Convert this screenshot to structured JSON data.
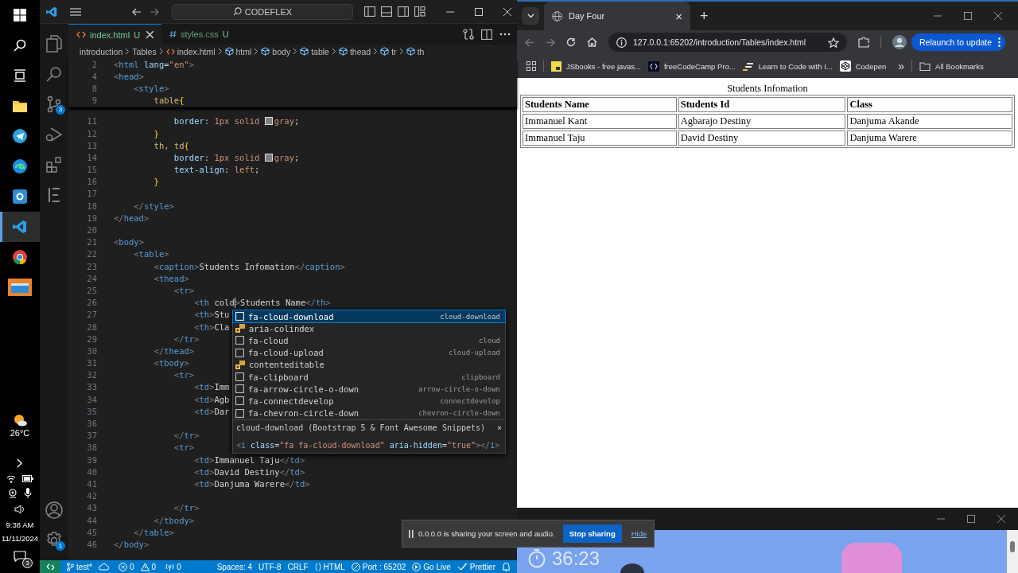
{
  "taskbar": {
    "apps": [
      {
        "kind": "start",
        "selected": false
      },
      {
        "kind": "search",
        "selected": false
      },
      {
        "kind": "taskview",
        "selected": false
      },
      {
        "kind": "folder",
        "selected": false
      },
      {
        "kind": "telegram",
        "selected": false
      },
      {
        "kind": "edge",
        "selected": false
      },
      {
        "kind": "camera",
        "selected": false
      },
      {
        "kind": "vscode",
        "selected": true
      },
      {
        "kind": "chrome",
        "selected": false
      },
      {
        "kind": "window",
        "selected": false
      }
    ],
    "weather": "26°C",
    "time": "9:38 AM",
    "date": "11/11/2024",
    "notifications": "3"
  },
  "editor": {
    "command_center": "CODEFLEX",
    "tabs": [
      {
        "label": "index.html",
        "status": "U",
        "kind": "html",
        "selected": true
      },
      {
        "label": "styles.css",
        "status": "U",
        "kind": "css",
        "selected": false
      }
    ],
    "breadcrumbs": [
      {
        "label": "introduction",
        "kind": "folder"
      },
      {
        "label": "Tables",
        "kind": "folder"
      },
      {
        "label": "index.html",
        "kind": "file"
      },
      {
        "label": "html",
        "kind": "element"
      },
      {
        "label": "body",
        "kind": "element"
      },
      {
        "label": "table",
        "kind": "element"
      },
      {
        "label": "thead",
        "kind": "element"
      },
      {
        "label": "tr",
        "kind": "element"
      },
      {
        "label": "th",
        "kind": "element"
      }
    ],
    "activity": [
      {
        "kind": "explorer"
      },
      {
        "kind": "search"
      },
      {
        "kind": "source-control",
        "badge": "3"
      },
      {
        "kind": "run"
      },
      {
        "kind": "extensions"
      },
      {
        "kind": "outline"
      }
    ],
    "activity_bottom": [
      {
        "kind": "account"
      },
      {
        "kind": "settings",
        "badge": "1"
      }
    ],
    "sticky_lines": [
      {
        "n": "2",
        "tokens": [
          {
            "kind": "punct",
            "text": "<"
          },
          {
            "kind": "tag",
            "text": "html"
          },
          {
            "kind": "attr",
            "text": " lang"
          },
          {
            "kind": "text",
            "text": "="
          },
          {
            "kind": "string",
            "text": "\"en\""
          },
          {
            "kind": "punct",
            "text": ">"
          }
        ]
      },
      {
        "n": "4",
        "tokens": [
          {
            "kind": "punct",
            "text": "<"
          },
          {
            "kind": "tag",
            "text": "head"
          },
          {
            "kind": "punct",
            "text": ">"
          }
        ]
      },
      {
        "n": "8",
        "tokens": [
          {
            "kind": "punct",
            "text": "    <"
          },
          {
            "kind": "tag",
            "text": "style"
          },
          {
            "kind": "punct",
            "text": ">"
          }
        ]
      },
      {
        "n": "9",
        "tokens": [
          {
            "kind": "selector",
            "text": "        table"
          },
          {
            "kind": "brace",
            "text": "{"
          }
        ]
      }
    ],
    "lines": [
      {
        "n": "11",
        "tokens": [
          {
            "kind": "property",
            "text": "            border"
          },
          {
            "kind": "text",
            "text": ": "
          },
          {
            "kind": "value",
            "text": "1px solid "
          },
          {
            "kind": "swatch"
          },
          {
            "kind": "value",
            "text": "gray"
          },
          {
            "kind": "text",
            "text": ";"
          }
        ]
      },
      {
        "n": "12",
        "tokens": [
          {
            "kind": "brace",
            "text": "        }"
          }
        ]
      },
      {
        "n": "13",
        "tokens": [
          {
            "kind": "selector",
            "text": "        th, td"
          },
          {
            "kind": "brace",
            "text": "{"
          }
        ]
      },
      {
        "n": "14",
        "tokens": [
          {
            "kind": "property",
            "text": "            border"
          },
          {
            "kind": "text",
            "text": ": "
          },
          {
            "kind": "value",
            "text": "1px solid "
          },
          {
            "kind": "swatch"
          },
          {
            "kind": "value",
            "text": "gray"
          },
          {
            "kind": "text",
            "text": ";"
          }
        ]
      },
      {
        "n": "15",
        "tokens": [
          {
            "kind": "property",
            "text": "            text-align"
          },
          {
            "kind": "text",
            "text": ": "
          },
          {
            "kind": "value",
            "text": "left"
          },
          {
            "kind": "text",
            "text": ";"
          }
        ]
      },
      {
        "n": "16",
        "tokens": [
          {
            "kind": "brace",
            "text": "        }"
          }
        ]
      },
      {
        "n": "17"
      },
      {
        "n": "18",
        "tokens": [
          {
            "kind": "punct",
            "text": "    </"
          },
          {
            "kind": "tag",
            "text": "style"
          },
          {
            "kind": "punct",
            "text": ">"
          }
        ]
      },
      {
        "n": "19",
        "tokens": [
          {
            "kind": "punct",
            "text": "</"
          },
          {
            "kind": "tag",
            "text": "head"
          },
          {
            "kind": "punct",
            "text": ">"
          }
        ]
      },
      {
        "n": "20"
      },
      {
        "n": "21",
        "tokens": [
          {
            "kind": "punct",
            "text": "<"
          },
          {
            "kind": "tag",
            "text": "body"
          },
          {
            "kind": "punct",
            "text": ">"
          }
        ]
      },
      {
        "n": "22",
        "tokens": [
          {
            "kind": "punct",
            "text": "    <"
          },
          {
            "kind": "tag",
            "text": "table"
          },
          {
            "kind": "punct",
            "text": ">"
          }
        ]
      },
      {
        "n": "23",
        "tokens": [
          {
            "kind": "punct",
            "text": "        <"
          },
          {
            "kind": "tag",
            "text": "caption"
          },
          {
            "kind": "punct",
            "text": ">"
          },
          {
            "kind": "text",
            "text": "Students Infomation"
          },
          {
            "kind": "punct",
            "text": "</"
          },
          {
            "kind": "tag",
            "text": "caption"
          },
          {
            "kind": "punct",
            "text": ">"
          }
        ]
      },
      {
        "n": "24",
        "tokens": [
          {
            "kind": "punct",
            "text": "        <"
          },
          {
            "kind": "tag",
            "text": "thead"
          },
          {
            "kind": "punct",
            "text": ">"
          }
        ]
      },
      {
        "n": "25",
        "tokens": [
          {
            "kind": "punct",
            "text": "            <"
          },
          {
            "kind": "tag",
            "text": "tr"
          },
          {
            "kind": "punct",
            "text": ">"
          }
        ]
      },
      {
        "n": "26",
        "tokens": [
          {
            "kind": "punct",
            "text": "                <"
          },
          {
            "kind": "tag",
            "text": "th"
          },
          {
            "kind": "text",
            "text": " cold"
          },
          {
            "kind": "caret"
          },
          {
            "kind": "punct",
            "text": ">"
          },
          {
            "kind": "text",
            "text": "Students Name"
          },
          {
            "kind": "punct",
            "text": "</"
          },
          {
            "kind": "tag",
            "text": "th"
          },
          {
            "kind": "punct",
            "text": ">"
          }
        ]
      },
      {
        "n": "27",
        "tokens": [
          {
            "kind": "punct",
            "text": "                <"
          },
          {
            "kind": "tag",
            "text": "th"
          },
          {
            "kind": "punct",
            "text": ">"
          },
          {
            "kind": "text",
            "text": "Stu"
          }
        ]
      },
      {
        "n": "28",
        "tokens": [
          {
            "kind": "punct",
            "text": "                <"
          },
          {
            "kind": "tag",
            "text": "th"
          },
          {
            "kind": "punct",
            "text": ">"
          },
          {
            "kind": "text",
            "text": "Cla"
          }
        ]
      },
      {
        "n": "29",
        "tokens": [
          {
            "kind": "punct",
            "text": "            </"
          },
          {
            "kind": "tag",
            "text": "tr"
          },
          {
            "kind": "punct",
            "text": ">"
          }
        ]
      },
      {
        "n": "30",
        "tokens": [
          {
            "kind": "punct",
            "text": "        </"
          },
          {
            "kind": "tag",
            "text": "thead"
          },
          {
            "kind": "punct",
            "text": ">"
          }
        ]
      },
      {
        "n": "31",
        "tokens": [
          {
            "kind": "punct",
            "text": "        <"
          },
          {
            "kind": "tag",
            "text": "tbody"
          },
          {
            "kind": "punct",
            "text": ">"
          }
        ]
      },
      {
        "n": "32",
        "tokens": [
          {
            "kind": "punct",
            "text": "            <"
          },
          {
            "kind": "tag",
            "text": "tr"
          },
          {
            "kind": "punct",
            "text": ">"
          }
        ]
      },
      {
        "n": "33",
        "tokens": [
          {
            "kind": "punct",
            "text": "                <"
          },
          {
            "kind": "tag",
            "text": "td"
          },
          {
            "kind": "punct",
            "text": ">"
          },
          {
            "kind": "text",
            "text": "Imm"
          }
        ]
      },
      {
        "n": "34",
        "tokens": [
          {
            "kind": "punct",
            "text": "                <"
          },
          {
            "kind": "tag",
            "text": "td"
          },
          {
            "kind": "punct",
            "text": ">"
          },
          {
            "kind": "text",
            "text": "Agb"
          }
        ]
      },
      {
        "n": "35",
        "tokens": [
          {
            "kind": "punct",
            "text": "                <"
          },
          {
            "kind": "tag",
            "text": "td"
          },
          {
            "kind": "punct",
            "text": ">"
          },
          {
            "kind": "text",
            "text": "Dar"
          }
        ]
      },
      {
        "n": "36"
      },
      {
        "n": "37",
        "tokens": [
          {
            "kind": "punct",
            "text": "            </"
          },
          {
            "kind": "tag",
            "text": "tr"
          },
          {
            "kind": "punct",
            "text": ">"
          }
        ]
      },
      {
        "n": "38",
        "tokens": [
          {
            "kind": "punct",
            "text": "            <"
          },
          {
            "kind": "tag",
            "text": "tr"
          },
          {
            "kind": "punct",
            "text": ">"
          }
        ]
      },
      {
        "n": "39",
        "tokens": [
          {
            "kind": "punct",
            "text": "                <"
          },
          {
            "kind": "tag",
            "text": "td"
          },
          {
            "kind": "punct",
            "text": ">"
          },
          {
            "kind": "text",
            "text": "Immanuel Taju"
          },
          {
            "kind": "punct",
            "text": "</"
          },
          {
            "kind": "tag",
            "text": "td"
          },
          {
            "kind": "punct",
            "text": ">"
          }
        ]
      },
      {
        "n": "40",
        "tokens": [
          {
            "kind": "punct",
            "text": "                <"
          },
          {
            "kind": "tag",
            "text": "td"
          },
          {
            "kind": "punct",
            "text": ">"
          },
          {
            "kind": "text",
            "text": "David Destiny"
          },
          {
            "kind": "punct",
            "text": "</"
          },
          {
            "kind": "tag",
            "text": "td"
          },
          {
            "kind": "punct",
            "text": ">"
          }
        ]
      },
      {
        "n": "41",
        "tokens": [
          {
            "kind": "punct",
            "text": "                <"
          },
          {
            "kind": "tag",
            "text": "td"
          },
          {
            "kind": "punct",
            "text": ">"
          },
          {
            "kind": "text",
            "text": "Danjuma Warere"
          },
          {
            "kind": "punct",
            "text": "</"
          },
          {
            "kind": "tag",
            "text": "td"
          },
          {
            "kind": "punct",
            "text": ">"
          }
        ]
      },
      {
        "n": "42"
      },
      {
        "n": "43",
        "tokens": [
          {
            "kind": "punct",
            "text": "            </"
          },
          {
            "kind": "tag",
            "text": "tr"
          },
          {
            "kind": "punct",
            "text": ">"
          }
        ]
      },
      {
        "n": "44",
        "tokens": [
          {
            "kind": "punct",
            "text": "        </"
          },
          {
            "kind": "tag",
            "text": "tbody"
          },
          {
            "kind": "punct",
            "text": ">"
          }
        ]
      },
      {
        "n": "45",
        "tokens": [
          {
            "kind": "punct",
            "text": "    </"
          },
          {
            "kind": "tag",
            "text": "table"
          },
          {
            "kind": "punct",
            "text": ">"
          }
        ]
      },
      {
        "n": "46",
        "tokens": [
          {
            "kind": "punct",
            "text": "</"
          },
          {
            "kind": "tag",
            "text": "body"
          },
          {
            "kind": "punct",
            "text": ">"
          }
        ]
      }
    ],
    "suggestions": [
      {
        "label": "fa-cloud-download",
        "detail": "cloud-download",
        "kind": "snippet",
        "selected": true
      },
      {
        "label": "aria-colindex",
        "kind": "property",
        "selected": false
      },
      {
        "label": "fa-cloud",
        "detail": "cloud",
        "kind": "snippet",
        "selected": false
      },
      {
        "label": "fa-cloud-upload",
        "detail": "cloud-upload",
        "kind": "snippet",
        "selected": false
      },
      {
        "label": "contenteditable",
        "kind": "property",
        "selected": false
      },
      {
        "label": "fa-clipboard",
        "detail": "clipboard",
        "kind": "snippet",
        "selected": false
      },
      {
        "label": "fa-arrow-circle-o-down",
        "detail": "arrow-circle-o-down",
        "kind": "snippet",
        "selected": false
      },
      {
        "label": "fa-connectdevelop",
        "detail": "connectdevelop",
        "kind": "snippet",
        "selected": false
      },
      {
        "label": "fa-chevron-circle-down",
        "detail": "chevron-circle-down",
        "kind": "snippet",
        "selected": false
      }
    ],
    "suggestion_details": {
      "title": "cloud-download (Bootstrap 5 & Font Awesome Snippets)",
      "close": "×",
      "snippet": [
        {
          "kind": "punct",
          "text": "<"
        },
        {
          "kind": "tag",
          "text": "i"
        },
        {
          "kind": "attr",
          "text": " class"
        },
        {
          "kind": "text",
          "text": "="
        },
        {
          "kind": "string",
          "text": "\"fa fa-cloud-download\""
        },
        {
          "kind": "attr",
          "text": " aria-hidden"
        },
        {
          "kind": "text",
          "text": "="
        },
        {
          "kind": "string",
          "text": "\"true\""
        },
        {
          "kind": "punct",
          "text": "></"
        },
        {
          "kind": "tag",
          "text": "i"
        },
        {
          "kind": "punct",
          "text": ">"
        }
      ]
    },
    "status_bar": {
      "left": [
        {
          "kind": "remote"
        },
        {
          "kind": "branch",
          "label": "test*"
        },
        {
          "kind": "sync"
        },
        {
          "kind": "error",
          "label": "0"
        },
        {
          "kind": "warning",
          "label": "0"
        },
        {
          "kind": "ports",
          "label": "0"
        }
      ],
      "right": [
        {
          "kind": "text",
          "label": "Spaces: 4"
        },
        {
          "kind": "text",
          "label": "UTF-8"
        },
        {
          "kind": "text",
          "label": "CRLF"
        },
        {
          "kind": "language",
          "label": "HTML"
        },
        {
          "kind": "port",
          "label": "Port : 65202"
        },
        {
          "kind": "live",
          "label": "Go Live"
        },
        {
          "kind": "prettier",
          "label": "Prettier"
        },
        {
          "kind": "bell"
        }
      ]
    }
  },
  "browser": {
    "tab": {
      "title": "Day Four",
      "close": "×"
    },
    "new_tab": "+",
    "url": "127.0.0.1:65202/introduction/Tables/index.html",
    "relaunch": "Relaunch to update",
    "bookmarks": [
      {
        "label": "JSbooks - free javas...",
        "kind": "js"
      },
      {
        "label": "freeCodeCamp Pro...",
        "kind": "fcc"
      },
      {
        "label": "Learn to Code with I...",
        "kind": "learn"
      },
      {
        "label": "Codepen",
        "kind": "codepen"
      }
    ],
    "more_bookmarks": "»",
    "all_bookmarks": "All Bookmarks",
    "page": {
      "caption": "Students Infomation",
      "columns": [
        "Students Name",
        "Students Id",
        "Class"
      ],
      "rows": [
        [
          "Immanuel Kant",
          "Agbarajo Destiny",
          "Danjuma Akande"
        ],
        [
          "Immanuel Taju",
          "David Destiny",
          "Danjuma Warere"
        ]
      ]
    }
  },
  "meeting_window": {
    "timer": "36:23"
  },
  "share_bar": {
    "message": "0.0.0.0 is sharing your screen and audio.",
    "stop": "Stop sharing",
    "hide": "Hide"
  }
}
